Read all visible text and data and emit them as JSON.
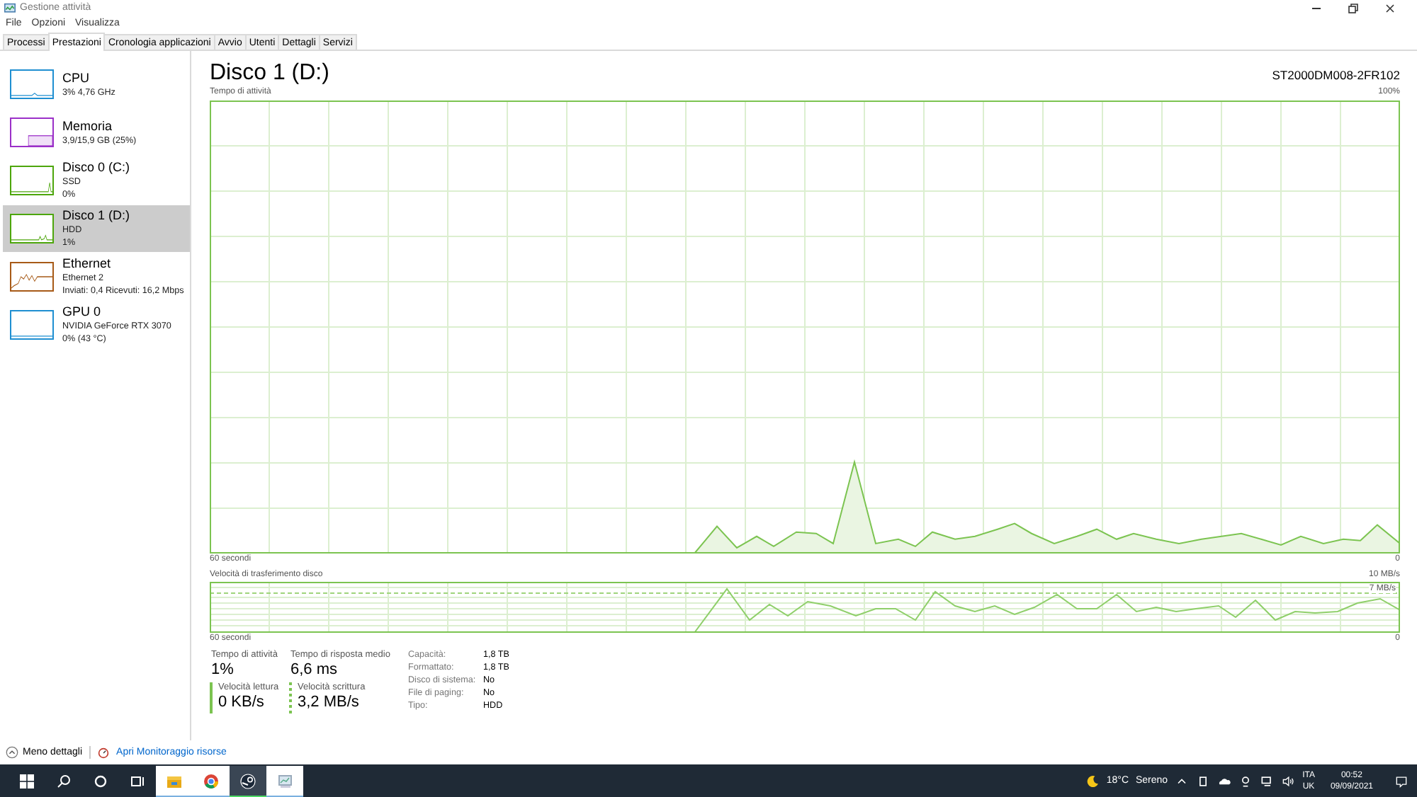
{
  "window": {
    "title": "Gestione attività"
  },
  "menu": [
    "File",
    "Opzioni",
    "Visualizza"
  ],
  "tabs": [
    {
      "label": "Processi",
      "selected": false
    },
    {
      "label": "Prestazioni",
      "selected": true
    },
    {
      "label": "Cronologia applicazioni",
      "selected": false
    },
    {
      "label": "Avvio",
      "selected": false
    },
    {
      "label": "Utenti",
      "selected": false
    },
    {
      "label": "Dettagli",
      "selected": false
    },
    {
      "label": "Servizi",
      "selected": false
    }
  ],
  "sidebar": {
    "items": [
      {
        "name": "CPU",
        "line1": "3% 4,76 GHz",
        "color": "#1f8fd1",
        "selected": false
      },
      {
        "name": "Memoria",
        "line1": "3,9/15,9 GB (25%)",
        "color": "#9b30c8",
        "selected": false
      },
      {
        "name": "Disco 0 (C:)",
        "line1": "SSD",
        "line2": "0%",
        "color": "#4da60c",
        "selected": false
      },
      {
        "name": "Disco 1 (D:)",
        "line1": "HDD",
        "line2": "1%",
        "color": "#4da60c",
        "selected": true
      },
      {
        "name": "Ethernet",
        "line1": "Ethernet 2",
        "line2": "Inviati: 0,4 Ricevuti: 16,2 Mbps",
        "color": "#a75a17",
        "selected": false
      },
      {
        "name": "GPU 0",
        "line1": "NVIDIA GeForce RTX 3070",
        "line2": "0% (43 °C)",
        "color": "#1f8fd1",
        "selected": false
      }
    ]
  },
  "detail": {
    "title": "Disco 1 (D:)",
    "model": "ST2000DM008-2FR102",
    "activity_chart": {
      "label": "Tempo di attività",
      "max": "100%",
      "xlabel": "60 secondi",
      "min": "0"
    },
    "transfer_chart": {
      "label": "Velocità di trasferimento disco",
      "max": "10 MB/s",
      "marker": "7 MB/s",
      "xlabel": "60 secondi",
      "min": "0"
    },
    "stats": [
      {
        "label": "Tempo di attività",
        "value": "1%",
        "kind": "plain"
      },
      {
        "label": "Tempo di risposta medio",
        "value": "6,6 ms",
        "kind": "plain"
      },
      {
        "label": "Velocità lettura",
        "value": "0 KB/s",
        "kind": "solid"
      },
      {
        "label": "Velocità scrittura",
        "value": "3,2 MB/s",
        "kind": "dotted"
      }
    ],
    "properties": [
      {
        "label": "Capacità:",
        "value": "1,8 TB"
      },
      {
        "label": "Formattato:",
        "value": "1,8 TB"
      },
      {
        "label": "Disco di sistema:",
        "value": "No"
      },
      {
        "label": "File di paging:",
        "value": "No"
      },
      {
        "label": "Tipo:",
        "value": "HDD"
      }
    ]
  },
  "footer": {
    "less": "Meno dettagli",
    "link": "Apri Monitoraggio risorse"
  },
  "taskbar": {
    "weather_temp": "18°C",
    "weather": "Sereno",
    "lang1": "ITA",
    "lang2": "UK",
    "time": "00:52",
    "date": "09/09/2021"
  }
}
